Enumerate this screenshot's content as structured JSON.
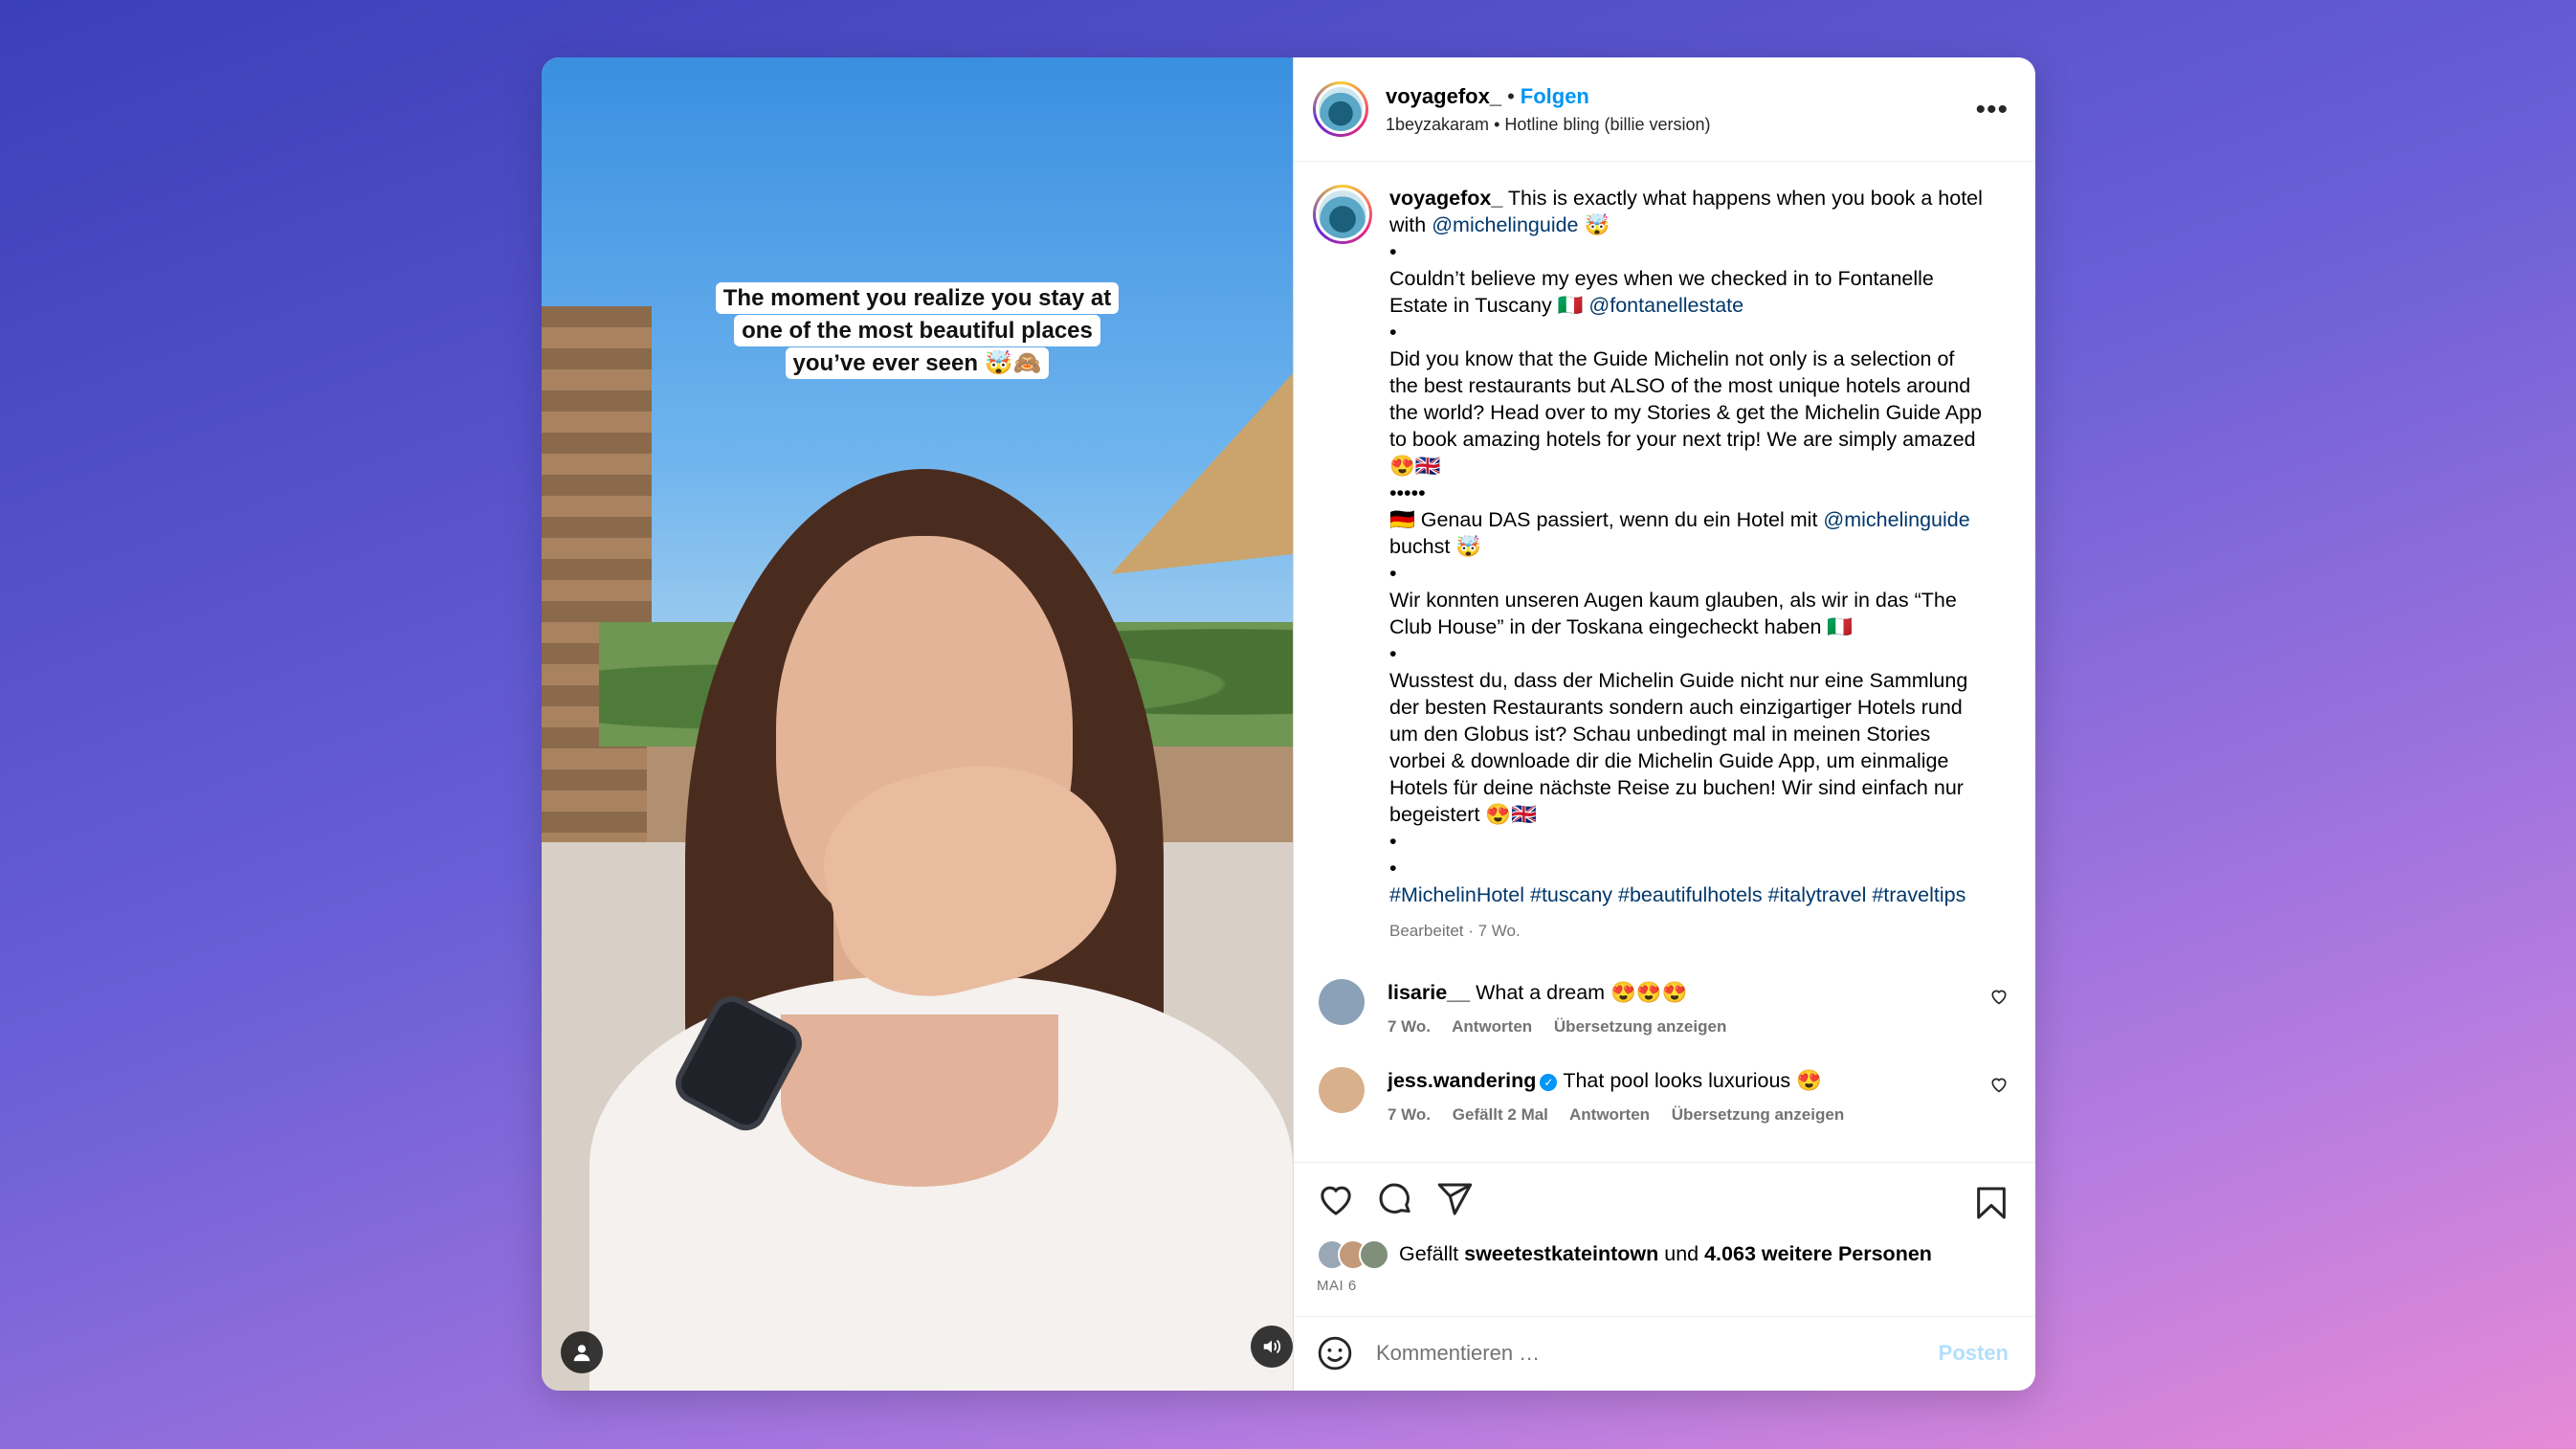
{
  "header": {
    "username": "voyagefox_",
    "separator": "•",
    "follow_label": "Folgen",
    "audio_user": "1beyzakaram",
    "audio_separator": "•",
    "audio_title": "Hotline bling (billie version)",
    "more_icon": "more-horizontal-icon"
  },
  "media": {
    "caption_lines": [
      "The moment you realize you stay at",
      "one of the most beautiful places",
      "you’ve ever seen 🤯🙈"
    ],
    "user_icon": "user-tag-icon",
    "sound_icon": "speaker-icon"
  },
  "post": {
    "username": "voyagefox_",
    "lines": [
      {
        "text": "This is exactly what happens when you book a hotel with ",
        "mention": "@michelinguide",
        "tail": " 🤯"
      },
      {
        "text": "•"
      },
      {
        "text": "Couldn’t believe my eyes when we checked in to Fontanelle Estate in Tuscany 🇮🇹 ",
        "mention": "@fontanellestate"
      },
      {
        "text": "•"
      },
      {
        "text": "Did you know that the Guide Michelin not only is a selection of the best restaurants but ALSO of the most unique hotels around the world? Head over to my Stories & get the Michelin Guide App to book amazing hotels for your next trip! We are simply amazed 😍🇬🇧"
      },
      {
        "text": "•••••"
      },
      {
        "text": "🇩🇪 Genau DAS passiert, wenn du ein Hotel mit ",
        "mention": "@michelinguide",
        "tail": " buchst 🤯"
      },
      {
        "text": "•"
      },
      {
        "text": "Wir konnten unseren Augen kaum glauben, als wir in das “The Club House” in der Toskana eingecheckt haben 🇮🇹"
      },
      {
        "text": "•"
      },
      {
        "text": "Wusstest du, dass der Michelin Guide nicht nur eine Sammlung der besten Restaurants sondern auch einzigartiger Hotels rund um den Globus ist? Schau unbedingt mal in meinen Stories vorbei & downloade dir die Michelin Guide App, um einmalige Hotels für deine nächste Reise zu buchen! Wir sind einfach nur begeistert 😍🇬🇧"
      },
      {
        "text": "•"
      },
      {
        "text": "•"
      }
    ],
    "hashtags": "#MichelinHotel #tuscany #beautifulhotels #italytravel #traveltips",
    "meta": "Bearbeitet · 7 Wo."
  },
  "comments": [
    {
      "username": "lisarie__",
      "text": "What a dream 😍😍😍",
      "time": "7 Wo.",
      "reply": "Antworten",
      "translate": "Übersetzung anzeigen",
      "avatar_color": "#8aa1b8"
    },
    {
      "username": "jess.wandering",
      "verified": true,
      "text": "That pool looks luxurious 😍",
      "time": "7 Wo.",
      "likes": "Gefällt 2 Mal",
      "reply": "Antworten",
      "translate": "Übersetzung anzeigen",
      "avatar_color": "#d9b08c"
    }
  ],
  "actions": {
    "like_icon": "heart-icon",
    "comment_icon": "comment-icon",
    "share_icon": "send-icon",
    "save_icon": "bookmark-icon",
    "likes_prefix": "Gefällt",
    "likes_user": "sweetestkateintown",
    "likes_mid": "und",
    "likes_others": "4.063 weitere Personen",
    "date": "MAI 6"
  },
  "comment_box": {
    "emoji_icon": "smiley-icon",
    "placeholder": "Kommentieren …",
    "post_label": "Posten"
  },
  "colors": {
    "accent": "#0095f6",
    "link": "#00376b",
    "muted": "#737373"
  }
}
